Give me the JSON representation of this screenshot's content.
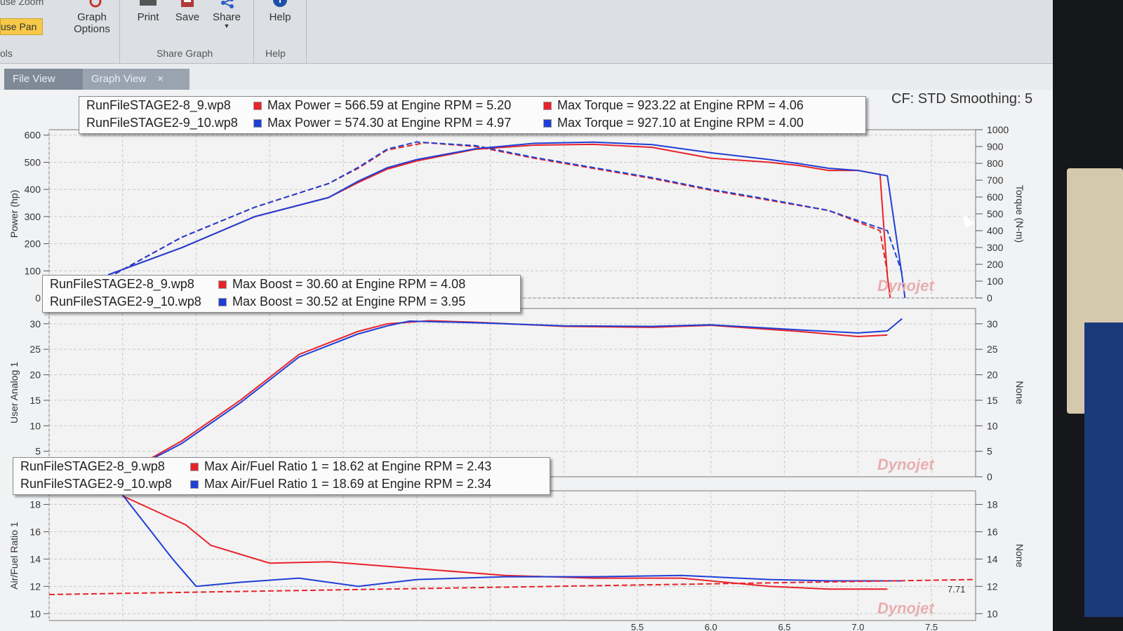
{
  "ribbon": {
    "partial_top_label": "use Zoom",
    "mouse_pan_label": "use Pan",
    "tools_group_label": "ols",
    "graph_options_label_1": "Graph",
    "graph_options_label_2": "Options",
    "print_label": "Print",
    "save_label": "Save",
    "share_label": "Share",
    "share_group_label": "Share Graph",
    "help_label": "Help",
    "help_group_label": "Help"
  },
  "tabs": [
    {
      "label": "File View",
      "active": false
    },
    {
      "label": "Graph View",
      "active": true,
      "close": "×"
    }
  ],
  "header": {
    "cf_text": "CF: STD Smoothing: 5"
  },
  "colors": {
    "run1": "#e8232a",
    "run2": "#1f3fd6",
    "background": "#f1f2f4",
    "grid": "#c9c9c9"
  },
  "legends": {
    "power": [
      {
        "file": "RunFileSTAGE2-8_9.wp8",
        "power": "Max Power = 566.59 at Engine RPM = 5.20",
        "torque": "Max Torque = 923.22 at Engine RPM = 4.06"
      },
      {
        "file": "RunFileSTAGE2-9_10.wp8",
        "power": "Max Power = 574.30 at Engine RPM = 4.97",
        "torque": "Max Torque = 927.10 at Engine RPM = 4.00"
      }
    ],
    "boost": [
      {
        "file": "RunFileSTAGE2-8_9.wp8",
        "text": "Max Boost = 30.60 at Engine RPM = 4.08"
      },
      {
        "file": "RunFileSTAGE2-9_10.wp8",
        "text": "Max Boost = 30.52 at Engine RPM = 3.95"
      }
    ],
    "afr": [
      {
        "file": "RunFileSTAGE2-8_9.wp8",
        "text": "Max Air/Fuel Ratio 1 = 18.62 at Engine RPM = 2.43"
      },
      {
        "file": "RunFileSTAGE2-9_10.wp8",
        "text": "Max Air/Fuel Ratio 1 = 18.69 at Engine RPM = 2.34"
      }
    ]
  },
  "watermark": "Dynojet",
  "chart_data": [
    {
      "type": "line",
      "ylabel": "Power (hp)",
      "y2label": "Torque (N-m)",
      "ylim": [
        0,
        620
      ],
      "y2lim": [
        0,
        1000
      ],
      "yticks": [
        "600",
        "500",
        "400",
        "300",
        "200",
        "100",
        "0"
      ],
      "y2ticks": [
        "1000",
        "900",
        "800",
        "700",
        "600",
        "500",
        "400",
        "300",
        "200",
        "100",
        "0"
      ],
      "xlim": [
        1.5,
        7.8
      ],
      "series": [
        {
          "name": "RunFileSTAGE2-8_9.wp8",
          "color": "#e8232a",
          "dash": false,
          "axis": "left",
          "x": [
            1.9,
            2.4,
            2.9,
            3.4,
            3.6,
            3.8,
            4.0,
            4.4,
            4.8,
            5.2,
            5.6,
            6.0,
            6.4,
            6.6,
            6.8,
            7.0,
            7.15,
            7.2,
            7.22
          ],
          "y": [
            85,
            185,
            300,
            370,
            425,
            475,
            505,
            548,
            563,
            566,
            555,
            515,
            500,
            488,
            470,
            470,
            455,
            80,
            0
          ]
        },
        {
          "name": "RunFileSTAGE2-9_10.wp8",
          "color": "#1f3fd6",
          "dash": false,
          "axis": "left",
          "x": [
            1.9,
            2.4,
            2.9,
            3.4,
            3.6,
            3.8,
            4.0,
            4.4,
            4.8,
            5.2,
            5.6,
            6.0,
            6.4,
            6.6,
            6.8,
            7.0,
            7.2,
            7.3,
            7.32
          ],
          "y": [
            85,
            185,
            300,
            370,
            430,
            480,
            510,
            550,
            570,
            574,
            565,
            535,
            510,
            495,
            478,
            470,
            450,
            80,
            0
          ]
        },
        {
          "name": "RunFileSTAGE2-8_9.wp8",
          "color": "#e8232a",
          "dash": true,
          "axis": "right",
          "x": [
            1.9,
            2.4,
            2.9,
            3.4,
            3.6,
            3.8,
            4.06,
            4.4,
            4.8,
            5.2,
            5.6,
            6.0,
            6.4,
            6.8,
            7.15,
            7.2
          ],
          "y": [
            120,
            360,
            540,
            680,
            770,
            880,
            923,
            900,
            830,
            770,
            710,
            640,
            580,
            520,
            400,
            150
          ]
        },
        {
          "name": "RunFileSTAGE2-9_10.wp8",
          "color": "#1f3fd6",
          "dash": true,
          "axis": "right",
          "x": [
            1.9,
            2.4,
            2.9,
            3.4,
            3.6,
            3.8,
            4.0,
            4.4,
            4.8,
            5.2,
            5.6,
            6.0,
            6.4,
            6.8,
            7.2,
            7.3
          ],
          "y": [
            120,
            360,
            540,
            680,
            775,
            885,
            927,
            905,
            835,
            775,
            715,
            645,
            585,
            520,
            400,
            150
          ]
        }
      ]
    },
    {
      "type": "line",
      "ylabel": "User Analog 1",
      "y2label": "None",
      "ylim": [
        0,
        33
      ],
      "y2lim": [
        0,
        33
      ],
      "yticks": [
        "30",
        "25",
        "20",
        "15",
        "10",
        "5"
      ],
      "y2ticks": [
        "30",
        "25",
        "20",
        "15",
        "10",
        "5",
        "0"
      ],
      "xlim": [
        1.5,
        7.8
      ],
      "series": [
        {
          "name": "RunFileSTAGE2-8_9.wp8",
          "color": "#e8232a",
          "x": [
            2.0,
            2.4,
            2.8,
            3.2,
            3.6,
            3.8,
            4.08,
            4.4,
            5.0,
            5.6,
            6.0,
            6.6,
            7.0,
            7.2
          ],
          "y": [
            0.5,
            7,
            15,
            24,
            28.5,
            30,
            30.6,
            30.3,
            29.5,
            29.3,
            29.7,
            28.5,
            27.5,
            27.8
          ]
        },
        {
          "name": "RunFileSTAGE2-9_10.wp8",
          "color": "#1f3fd6",
          "x": [
            2.0,
            2.4,
            2.8,
            3.2,
            3.6,
            3.8,
            3.95,
            4.4,
            5.0,
            5.6,
            6.0,
            6.6,
            7.0,
            7.2,
            7.3
          ],
          "y": [
            0.5,
            6.5,
            14.5,
            23.5,
            28,
            29.6,
            30.52,
            30.2,
            29.6,
            29.5,
            29.8,
            28.8,
            28.2,
            28.6,
            31
          ]
        }
      ]
    },
    {
      "type": "line",
      "ylabel": "Air/Fuel Ratio 1",
      "y2label": "None",
      "ylim": [
        9.5,
        19
      ],
      "y2lim": [
        9.5,
        19
      ],
      "yticks": [
        "18",
        "16",
        "14",
        "12",
        "10"
      ],
      "y2ticks": [
        "18",
        "16",
        "14",
        "12",
        "10"
      ],
      "xlim": [
        1.5,
        7.8
      ],
      "xticks": [
        "5.5",
        "6.0",
        "6.5",
        "7.0",
        "7.5"
      ],
      "annotation": "7.71",
      "series": [
        {
          "name": "RunFileSTAGE2-8_9.wp8",
          "color": "#e8232a",
          "x": [
            2.0,
            2.43,
            2.6,
            3.0,
            3.4,
            4.0,
            4.6,
            5.2,
            5.8,
            6.4,
            6.8,
            7.2
          ],
          "y": [
            18.62,
            16.5,
            15.0,
            13.7,
            13.8,
            13.3,
            12.8,
            12.6,
            12.6,
            12.0,
            11.8,
            11.8
          ]
        },
        {
          "name": "RunFileSTAGE2-9_10.wp8",
          "color": "#1f3fd6",
          "x": [
            2.0,
            2.34,
            2.5,
            2.8,
            3.2,
            3.6,
            4.0,
            4.6,
            5.2,
            5.8,
            6.4,
            6.8,
            7.3
          ],
          "y": [
            18.69,
            14.0,
            12.0,
            12.3,
            12.6,
            12.0,
            12.5,
            12.7,
            12.7,
            12.8,
            12.5,
            12.4,
            12.4
          ]
        },
        {
          "name": "",
          "color": "#e8232a",
          "dash": true,
          "x": [
            1.5,
            7.8
          ],
          "y": [
            11.4,
            12.5
          ]
        }
      ]
    }
  ]
}
